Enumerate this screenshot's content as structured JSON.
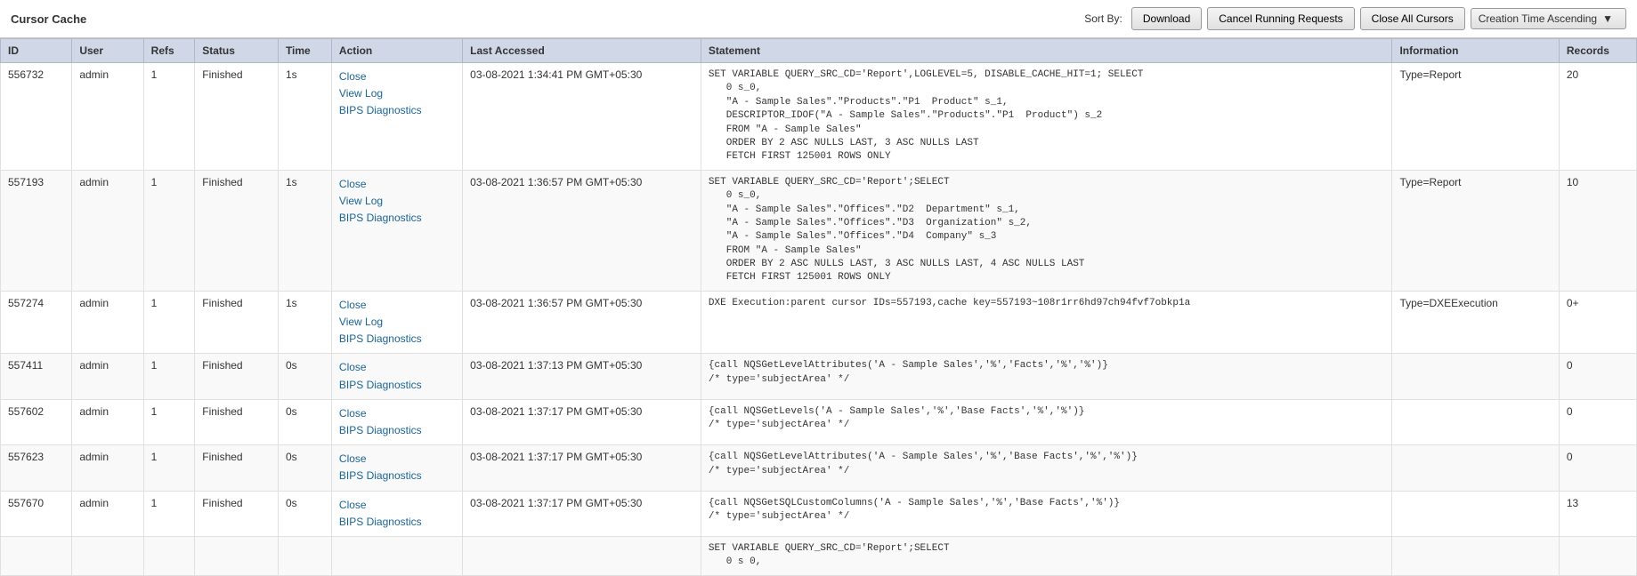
{
  "title": "Cursor Cache",
  "sortBy": {
    "label": "Sort By:",
    "value": "Creation Time Ascending"
  },
  "buttons": {
    "download": "Download",
    "cancelRunning": "Cancel Running Requests",
    "closeAll": "Close All Cursors"
  },
  "columns": {
    "id": "ID",
    "user": "User",
    "refs": "Refs",
    "status": "Status",
    "time": "Time",
    "action": "Action",
    "lastAccessed": "Last Accessed",
    "statement": "Statement",
    "information": "Information",
    "records": "Records"
  },
  "rows": [
    {
      "id": "556732",
      "user": "admin",
      "refs": "1",
      "status": "Finished",
      "time": "1s",
      "actions": [
        "Close",
        "View Log",
        "BIPS Diagnostics"
      ],
      "lastAccessed": "03-08-2021 1:34:41 PM GMT+05:30",
      "statement": "SET VARIABLE QUERY_SRC_CD='Report',LOGLEVEL=5, DISABLE_CACHE_HIT=1; SELECT\n   0 s_0,\n   \"A - Sample Sales\".\"Products\".\"P1  Product\" s_1,\n   DESCRIPTOR_IDOF(\"A - Sample Sales\".\"Products\".\"P1  Product\") s_2\n   FROM \"A - Sample Sales\"\n   ORDER BY 2 ASC NULLS LAST, 3 ASC NULLS LAST\n   FETCH FIRST 125001 ROWS ONLY",
      "information": "Type=Report",
      "records": "20"
    },
    {
      "id": "557193",
      "user": "admin",
      "refs": "1",
      "status": "Finished",
      "time": "1s",
      "actions": [
        "Close",
        "View Log",
        "BIPS Diagnostics"
      ],
      "lastAccessed": "03-08-2021 1:36:57 PM GMT+05:30",
      "statement": "SET VARIABLE QUERY_SRC_CD='Report';SELECT\n   0 s_0,\n   \"A - Sample Sales\".\"Offices\".\"D2  Department\" s_1,\n   \"A - Sample Sales\".\"Offices\".\"D3  Organization\" s_2,\n   \"A - Sample Sales\".\"Offices\".\"D4  Company\" s_3\n   FROM \"A - Sample Sales\"\n   ORDER BY 2 ASC NULLS LAST, 3 ASC NULLS LAST, 4 ASC NULLS LAST\n   FETCH FIRST 125001 ROWS ONLY",
      "information": "Type=Report",
      "records": "10"
    },
    {
      "id": "557274",
      "user": "admin",
      "refs": "1",
      "status": "Finished",
      "time": "1s",
      "actions": [
        "Close",
        "View Log",
        "BIPS Diagnostics"
      ],
      "lastAccessed": "03-08-2021 1:36:57 PM GMT+05:30",
      "statement": "DXE Execution:parent cursor IDs=557193,cache key=557193~108r1rr6hd97ch94fvf7obkp1a",
      "information": "Type=DXEExecution",
      "records": "0+"
    },
    {
      "id": "557411",
      "user": "admin",
      "refs": "1",
      "status": "Finished",
      "time": "0s",
      "actions": [
        "Close",
        "BIPS Diagnostics"
      ],
      "lastAccessed": "03-08-2021 1:37:13 PM GMT+05:30",
      "statement": "{call NQSGetLevelAttributes('A - Sample Sales','%','Facts','%','%')}\n/* type='subjectArea' */",
      "information": "",
      "records": "0"
    },
    {
      "id": "557602",
      "user": "admin",
      "refs": "1",
      "status": "Finished",
      "time": "0s",
      "actions": [
        "Close",
        "BIPS Diagnostics"
      ],
      "lastAccessed": "03-08-2021 1:37:17 PM GMT+05:30",
      "statement": "{call NQSGetLevels('A - Sample Sales','%','Base Facts','%','%')}\n/* type='subjectArea' */",
      "information": "",
      "records": "0"
    },
    {
      "id": "557623",
      "user": "admin",
      "refs": "1",
      "status": "Finished",
      "time": "0s",
      "actions": [
        "Close",
        "BIPS Diagnostics"
      ],
      "lastAccessed": "03-08-2021 1:37:17 PM GMT+05:30",
      "statement": "{call NQSGetLevelAttributes('A - Sample Sales','%','Base Facts','%','%')}\n/* type='subjectArea' */",
      "information": "",
      "records": "0"
    },
    {
      "id": "557670",
      "user": "admin",
      "refs": "1",
      "status": "Finished",
      "time": "0s",
      "actions": [
        "Close",
        "BIPS Diagnostics"
      ],
      "lastAccessed": "03-08-2021 1:37:17 PM GMT+05:30",
      "statement": "{call NQSGetSQLCustomColumns('A - Sample Sales','%','Base Facts','%')}\n/* type='subjectArea' */",
      "information": "",
      "records": "13"
    },
    {
      "id": "",
      "user": "",
      "refs": "",
      "status": "",
      "time": "",
      "actions": [],
      "lastAccessed": "",
      "statement": "SET VARIABLE QUERY_SRC_CD='Report';SELECT\n   0 s 0,",
      "information": "",
      "records": ""
    }
  ]
}
